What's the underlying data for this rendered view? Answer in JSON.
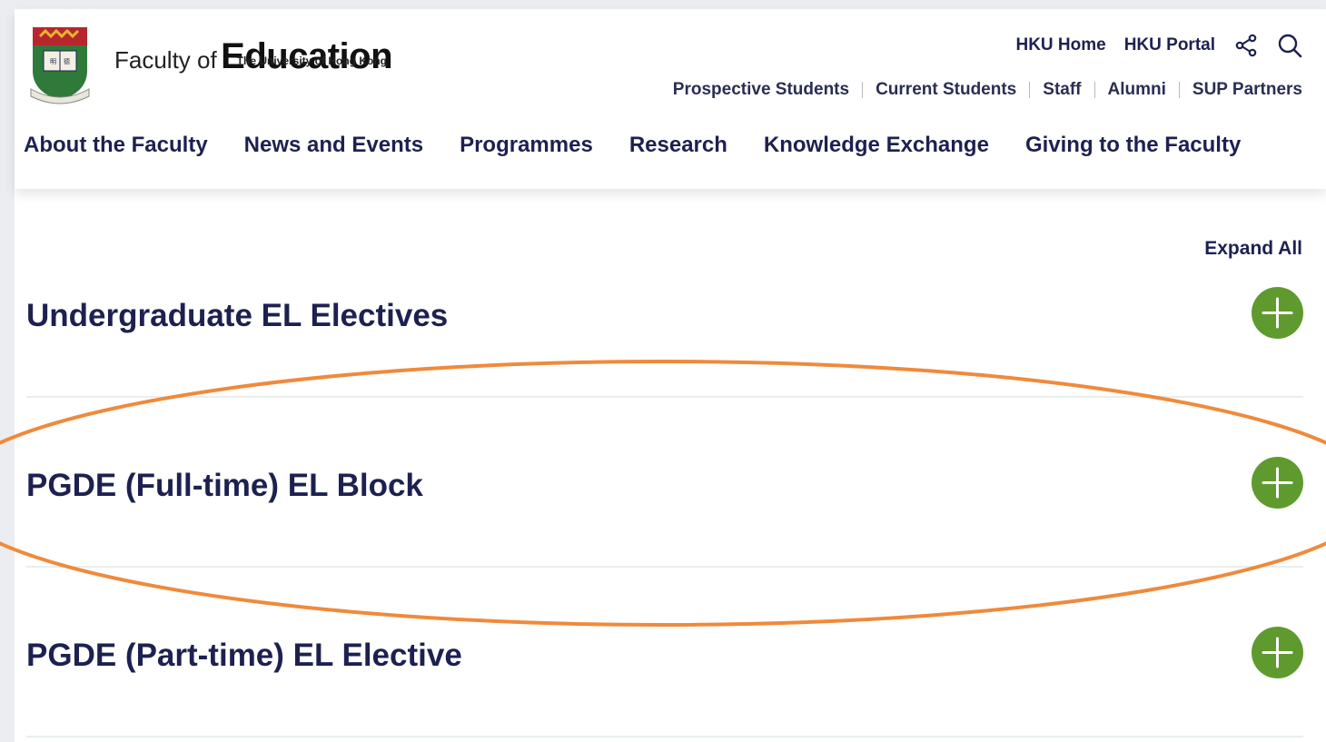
{
  "brand": {
    "faculty_prefix": "Faculty of",
    "faculty_name": "Education",
    "university": "The University of Hong Kong",
    "crest_motto": "SAPIENTIA ET VIRTUS"
  },
  "top_links": [
    {
      "label": "HKU Home"
    },
    {
      "label": "HKU Portal"
    }
  ],
  "icons": {
    "share": "share-icon",
    "search": "search-icon",
    "toggle": "plus-icon"
  },
  "audience_links": [
    {
      "label": "Prospective Students"
    },
    {
      "label": "Current Students"
    },
    {
      "label": "Staff"
    },
    {
      "label": "Alumni"
    },
    {
      "label": "SUP Partners"
    }
  ],
  "main_nav": [
    {
      "label": "About the Faculty"
    },
    {
      "label": "News and Events"
    },
    {
      "label": "Programmes"
    },
    {
      "label": "Research"
    },
    {
      "label": "Knowledge Exchange"
    },
    {
      "label": "Giving to the Faculty"
    }
  ],
  "content": {
    "expand_all": "Expand All",
    "accordion": [
      {
        "title": "Undergraduate EL Electives",
        "expanded": false
      },
      {
        "title": "PGDE (Full-time) EL Block",
        "expanded": false,
        "highlighted": true
      },
      {
        "title": "PGDE (Part-time) EL Elective",
        "expanded": false
      }
    ]
  },
  "colors": {
    "navy": "#1d2150",
    "toggle_green": "#5f9a2e",
    "highlight_orange": "#ef8a3c",
    "divider": "#e8eef0"
  }
}
